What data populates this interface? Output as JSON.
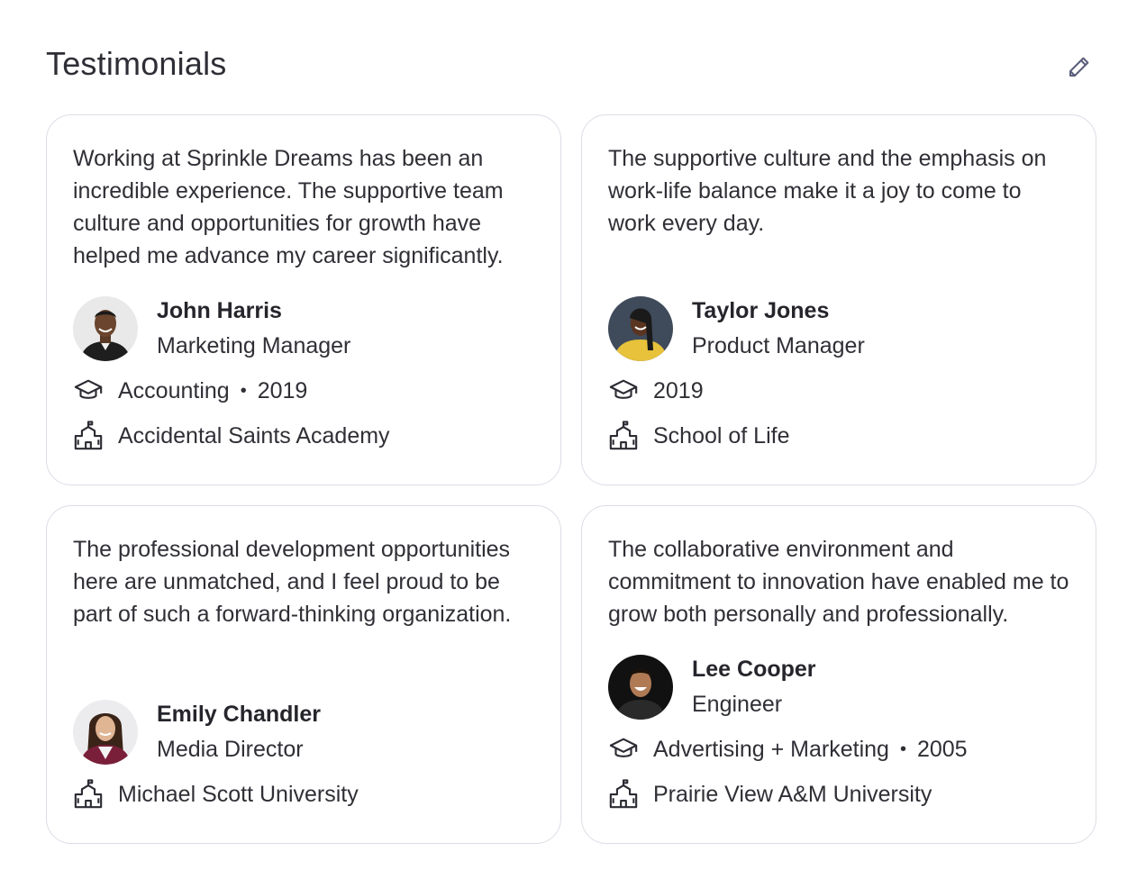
{
  "section": {
    "title": "Testimonials"
  },
  "icons": {
    "edit": "pencil-icon",
    "education": "graduation-cap-icon",
    "school": "school-building-icon"
  },
  "colors": {
    "border": "#dcdde6",
    "text": "#2f2f36",
    "icon": "#5a5d7a"
  },
  "cards": [
    {
      "quote": "Working at Sprinkle Dreams has been an incredible experience. The supportive team culture and opportunities for growth have helped me advance my career significantly.",
      "name": "John Harris",
      "role": "Marketing Manager",
      "field": "Accounting",
      "year": "2019",
      "school": "Accidental Saints Academy"
    },
    {
      "quote": "The supportive culture and the emphasis on work-life balance make it a joy to come to work every day.",
      "name": "Taylor Jones",
      "role": "Product Manager",
      "year": "2019",
      "school": "School of Life"
    },
    {
      "quote": "The professional development opportunities here are unmatched, and I feel proud to be part of such a forward-thinking organization.",
      "name": "Emily Chandler",
      "role": "Media Director",
      "school": "Michael Scott University"
    },
    {
      "quote": "The collaborative environment and commitment to innovation have enabled me to grow both personally and professionally.",
      "name": "Lee Cooper",
      "role": "Engineer",
      "field": "Advertising + Marketing",
      "year": "2005",
      "school": "Prairie View A&M University"
    }
  ]
}
